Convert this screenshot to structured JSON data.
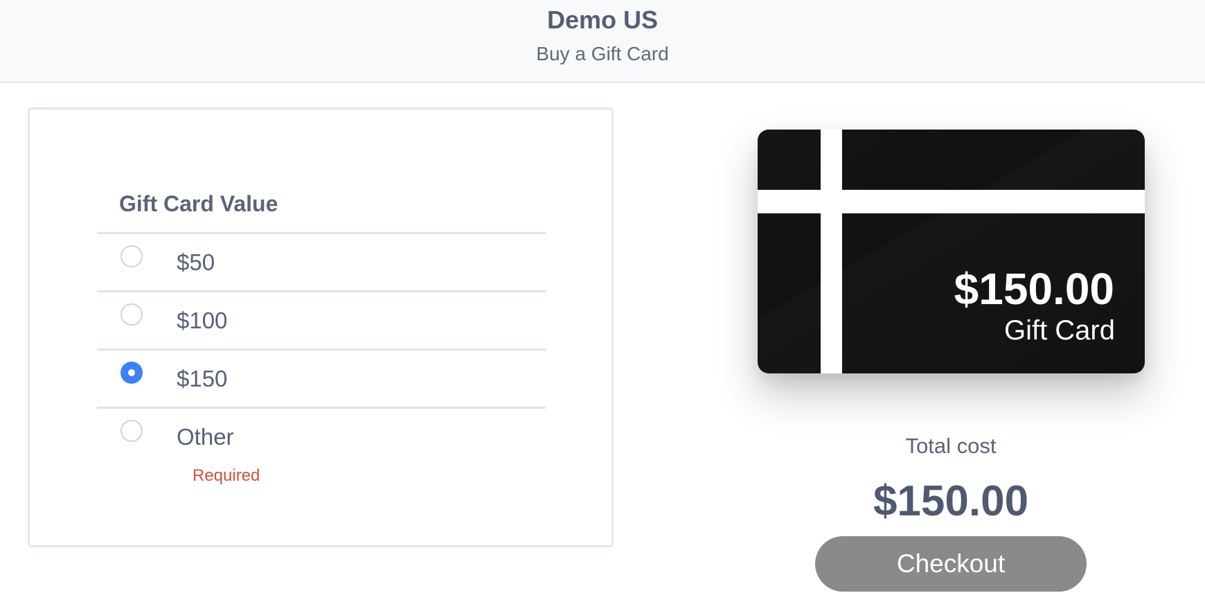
{
  "header": {
    "store_name": "Demo US",
    "subtitle": "Buy a Gift Card"
  },
  "form": {
    "section_title": "Gift Card Value",
    "options": [
      {
        "label": "$50",
        "selected": false
      },
      {
        "label": "$100",
        "selected": false
      },
      {
        "label": "$150",
        "selected": true
      },
      {
        "label": "Other",
        "selected": false
      }
    ],
    "validation_message": "Required"
  },
  "card_preview": {
    "amount": "$150.00",
    "card_type": "Gift Card"
  },
  "summary": {
    "total_label": "Total cost",
    "total_value": "$150.00",
    "checkout_label": "Checkout"
  },
  "colors": {
    "accent": "#3b82f6",
    "error": "#d4503a",
    "button_disabled": "#8a8a8a",
    "card_background": "#121212"
  }
}
